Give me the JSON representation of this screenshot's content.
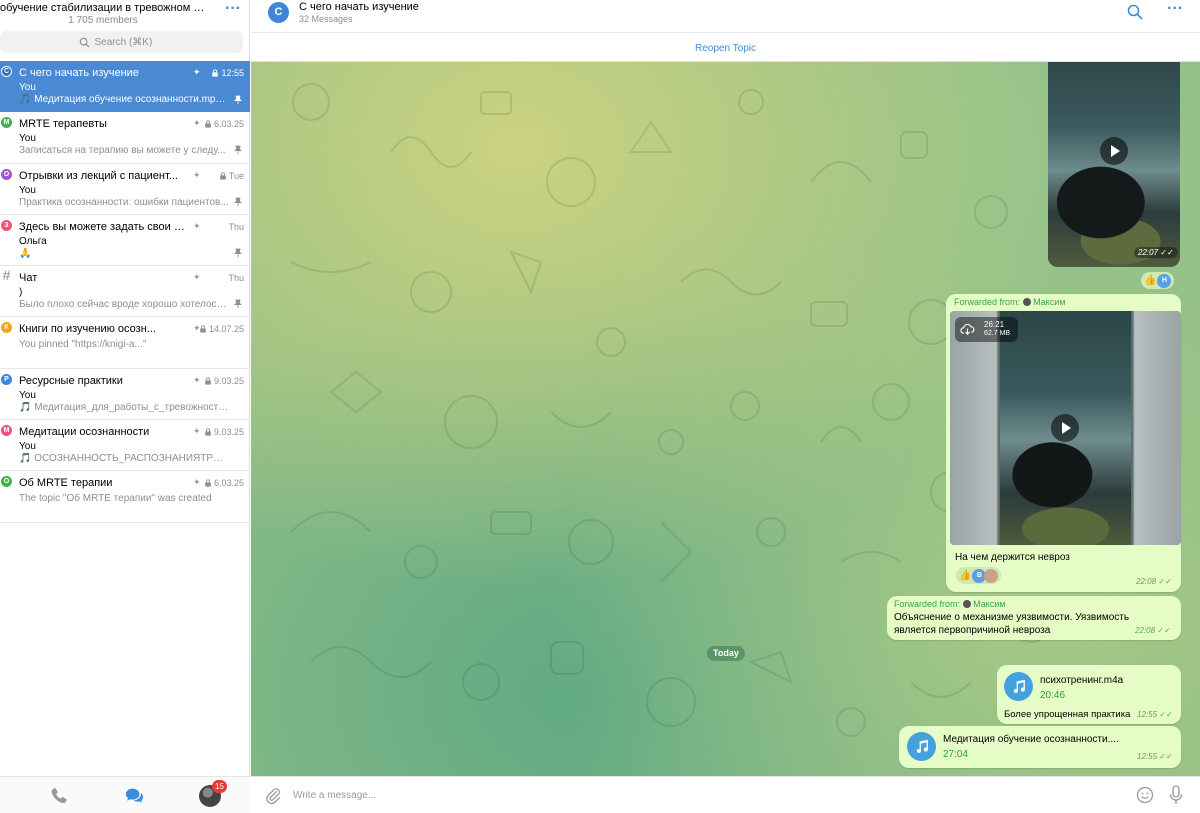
{
  "sidebar": {
    "group_title": "обучение стабилизации в тревожном расс...",
    "members": "1 705 members",
    "search_placeholder": "Search (⌘K)",
    "topics": [
      {
        "badge": "С",
        "color": "#4a8ad4",
        "title": "С чего начать изучение",
        "time": "12:55",
        "sender": "You",
        "preview": "🎵 Медитация обучение осознанности.mp3 - ...",
        "active": true
      },
      {
        "badge": "M",
        "color": "#3cb648",
        "title": "MRTE терапевты",
        "time": "6.03.25",
        "sender": "You",
        "preview": "Записаться на терапию вы можете у следу...",
        "active": false
      },
      {
        "badge": "О",
        "color": "#9b59d0",
        "title": "Отрывки из лекций с пациент...",
        "time": "Tue",
        "sender": "You",
        "preview": "Практика осознанности: ошибки пациентов...",
        "active": false
      },
      {
        "badge": "З",
        "color": "#e8547a",
        "title": "Здесь вы можете задать свои воп...",
        "time": "Thu",
        "sender": "Ольга",
        "preview": "🙏",
        "active": false
      },
      {
        "badge": "#",
        "color": "transparent",
        "title": "Чат",
        "time": "Thu",
        "sender": ")",
        "preview": "Было плохо сейчас вроде хорошо хотелось...",
        "active": false
      },
      {
        "badge": "К",
        "color": "#f0a31f",
        "title": "Книги по изучению осозн...",
        "time": "14.07.25",
        "sender": "",
        "preview": "You pinned \"https://knigi-a...\"",
        "active": false
      },
      {
        "badge": "Р",
        "color": "#3d86d8",
        "title": "Ресурсные практики",
        "time": "9.03.25",
        "sender": "You",
        "preview": "🎵 Медитация_для_работы_с_тревожностью,...",
        "active": false
      },
      {
        "badge": "М",
        "color": "#e8547a",
        "title": "Медитации осознанности",
        "time": "9.03.25",
        "sender": "You",
        "preview": "🎵 ОСОЗНАННОСТЬ_РАСПОЗНАНИЯТРЕНИН...",
        "active": false
      },
      {
        "badge": "О",
        "color": "#3cb648",
        "title": "Об MRTE терапии",
        "time": "6.03.25",
        "sender": "",
        "preview": "The topic \"Об MRTE терапии\" was created",
        "active": false
      }
    ],
    "tabs": {
      "calls": "phone-icon",
      "chats": "chats-icon",
      "settings_badge": "15"
    }
  },
  "chat": {
    "avatar_letter": "С",
    "title": "С чего начать изучение",
    "subtitle": "32 Messages",
    "reopen_label": "Reopen Topic",
    "today_label": "Today",
    "input_placeholder": "Write a message...",
    "messages": {
      "video1": {
        "time": "22:07",
        "reactions": [
          "👍",
          "Н"
        ]
      },
      "video2": {
        "forwarded_label": "Forwarded from:",
        "forwarded_name": "Максим",
        "duration": "26:21",
        "size": "62.7 MB",
        "caption": "На чем держится невроз",
        "time": "22:08",
        "reactions": [
          "👍",
          "В"
        ]
      },
      "text1": {
        "forwarded_label": "Forwarded from:",
        "forwarded_name": "Максим",
        "text": "Объяснение о механизме уязвимости. Уязвимость является первопричиной невроза",
        "time": "22:08"
      },
      "audio1": {
        "name": "психотренинг.m4a",
        "duration": "20:46",
        "caption": "Более упрощенная практика",
        "time": "12:55"
      },
      "audio2": {
        "name": "Медитация обучение осознанности....",
        "duration": "27:04",
        "time": "12:55"
      }
    }
  },
  "colors": {
    "accent": "#3a8ddb",
    "active_row": "#4a8ad4",
    "bubble": "#e6fcc6",
    "audio": "#44a1dd"
  }
}
